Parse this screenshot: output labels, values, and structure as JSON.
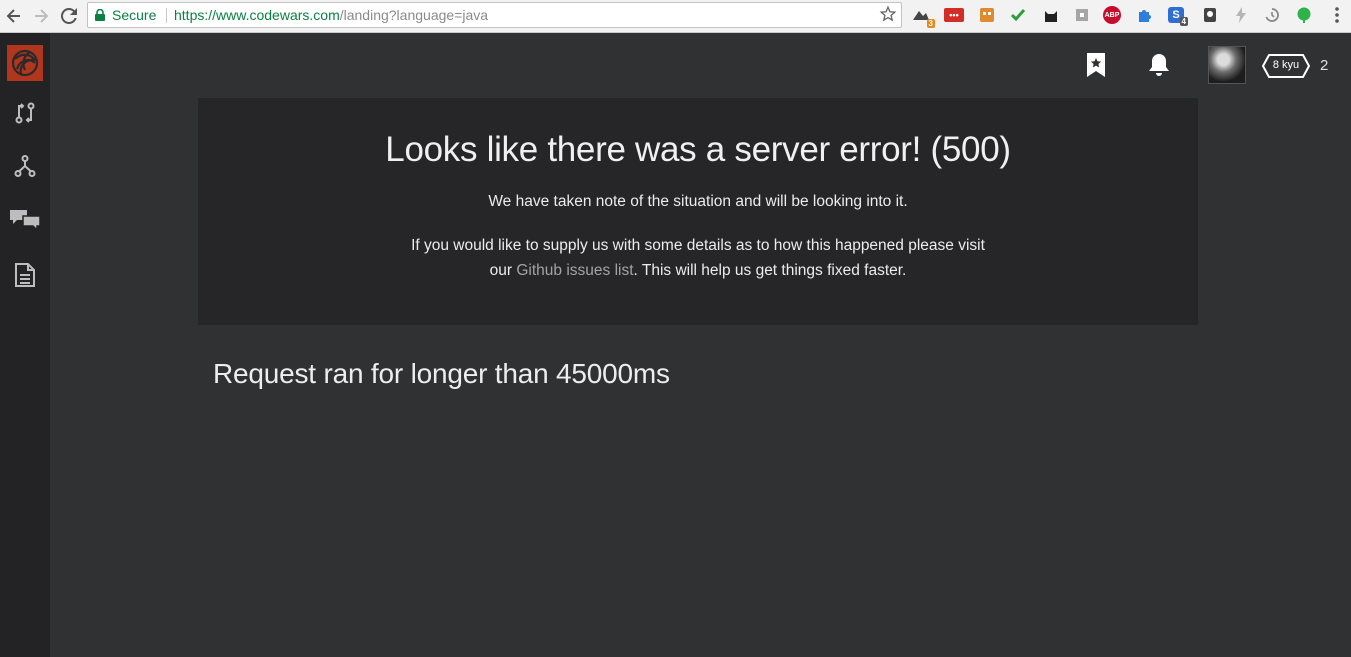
{
  "browser": {
    "secure_label": "Secure",
    "url_scheme": "https://",
    "url_host": "www.codewars.com",
    "url_path": "/landing?language=java",
    "extensions": [
      {
        "name": "ext-1",
        "badge": "3",
        "color": "#444"
      },
      {
        "name": "ext-lastpass",
        "badge": "",
        "color": "#d32d27"
      },
      {
        "name": "ext-3",
        "badge": "",
        "color": "#e08a2e"
      },
      {
        "name": "ext-check",
        "badge": "",
        "color": "#2e9e3b"
      },
      {
        "name": "ext-5",
        "badge": "",
        "color": "#222"
      },
      {
        "name": "ext-6",
        "badge": "",
        "color": "#8a8a8a"
      },
      {
        "name": "ext-abp",
        "badge": "",
        "color": "#c70d2c"
      },
      {
        "name": "ext-puzzle",
        "badge": "",
        "color": "#2f7fd8"
      },
      {
        "name": "ext-s",
        "badge": "4",
        "color": "#2f6fd1"
      },
      {
        "name": "ext-bulb",
        "badge": "",
        "color": "#444"
      },
      {
        "name": "ext-bolt",
        "badge": "",
        "color": "#aaa"
      },
      {
        "name": "ext-history",
        "badge": "",
        "color": "#888"
      },
      {
        "name": "ext-evernote",
        "badge": "",
        "color": "#2eb34a"
      }
    ]
  },
  "header": {
    "rank": "8 kyu",
    "honor": "2"
  },
  "error": {
    "title": "Looks like there was a server error! (500)",
    "note": "We have taken note of the situation and will be looking into it.",
    "help_before": "If you would like to supply us with some details as to how this happened please visit our ",
    "help_link": "Github issues list",
    "help_after": ". This will help us get things fixed faster."
  },
  "request_message": "Request ran for longer than 45000ms",
  "colors": {
    "page_bg": "#303133",
    "sidebar_bg": "#232325",
    "panel_bg": "#262628",
    "logo_red": "#b1361e",
    "link": "#a3a3a3"
  }
}
